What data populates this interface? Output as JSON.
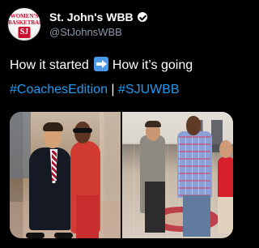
{
  "tweet": {
    "avatar": {
      "lettering": "WOMEN'S BASKETBALL",
      "mark": "SJ"
    },
    "display_name": "St. John's WBB",
    "handle": "@StJohnsWBB",
    "text": {
      "line1_before_arrow": "How it started",
      "arrow_icon": "right-arrow-icon",
      "line1_after_arrow": "How it’s going",
      "hashtag_1": "#CoachesEdition",
      "separator": "|",
      "hashtag_2": "#SJUWBB"
    },
    "colors": {
      "background": "#000000",
      "link": "#1d9bf0",
      "secondary_text": "#8b98a5",
      "brand_red": "#c8102e"
    }
  }
}
